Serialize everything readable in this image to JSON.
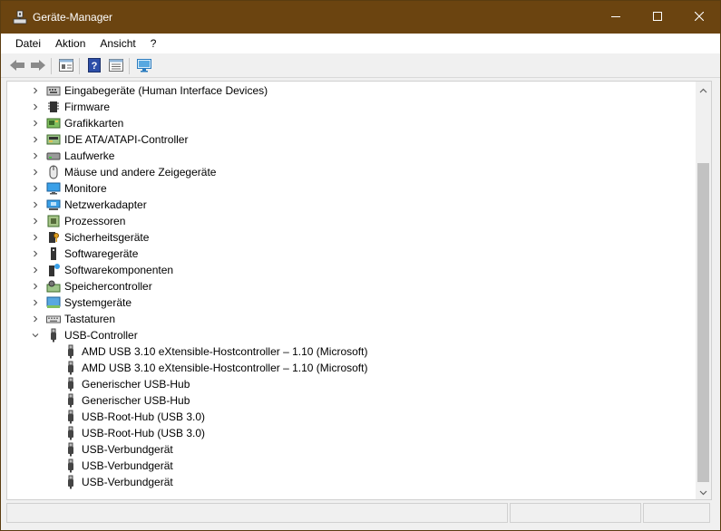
{
  "window": {
    "title": "Geräte-Manager",
    "controls": {
      "minimize": "minimize-icon",
      "maximize": "maximize-icon",
      "close": "close-icon"
    }
  },
  "menu": [
    "Datei",
    "Aktion",
    "Ansicht",
    "?"
  ],
  "toolbar": [
    "back-arrow-icon",
    "forward-arrow-icon",
    "properties-icon",
    "help-icon",
    "view-icon",
    "monitor-scan-icon"
  ],
  "tree": {
    "categories": [
      {
        "label": "Eingabegeräte (Human Interface Devices)",
        "icon": "hid-icon",
        "expanded": false
      },
      {
        "label": "Firmware",
        "icon": "firmware-icon",
        "expanded": false
      },
      {
        "label": "Grafikkarten",
        "icon": "display-adapter-icon",
        "expanded": false
      },
      {
        "label": "IDE ATA/ATAPI-Controller",
        "icon": "ide-controller-icon",
        "expanded": false
      },
      {
        "label": "Laufwerke",
        "icon": "disk-drive-icon",
        "expanded": false
      },
      {
        "label": "Mäuse und andere Zeigegeräte",
        "icon": "mouse-icon",
        "expanded": false
      },
      {
        "label": "Monitore",
        "icon": "monitor-icon",
        "expanded": false
      },
      {
        "label": "Netzwerkadapter",
        "icon": "network-adapter-icon",
        "expanded": false
      },
      {
        "label": "Prozessoren",
        "icon": "processor-icon",
        "expanded": false
      },
      {
        "label": "Sicherheitsgeräte",
        "icon": "security-device-icon",
        "expanded": false
      },
      {
        "label": "Softwaregeräte",
        "icon": "software-device-icon",
        "expanded": false
      },
      {
        "label": "Softwarekomponenten",
        "icon": "software-component-icon",
        "expanded": false
      },
      {
        "label": "Speichercontroller",
        "icon": "storage-controller-icon",
        "expanded": false
      },
      {
        "label": "Systemgeräte",
        "icon": "system-device-icon",
        "expanded": false
      },
      {
        "label": "Tastaturen",
        "icon": "keyboard-icon",
        "expanded": false
      },
      {
        "label": "USB-Controller",
        "icon": "usb-icon",
        "expanded": true
      }
    ],
    "usb_children": [
      "AMD USB 3.10 eXtensible-Hostcontroller – 1.10 (Microsoft)",
      "AMD USB 3.10 eXtensible-Hostcontroller – 1.10 (Microsoft)",
      "Generischer USB-Hub",
      "Generischer USB-Hub",
      "USB-Root-Hub (USB 3.0)",
      "USB-Root-Hub (USB 3.0)",
      "USB-Verbundgerät",
      "USB-Verbundgerät",
      "USB-Verbundgerät"
    ]
  },
  "colors": {
    "titlebar": "#6b4410",
    "accent": "#0078d7"
  }
}
